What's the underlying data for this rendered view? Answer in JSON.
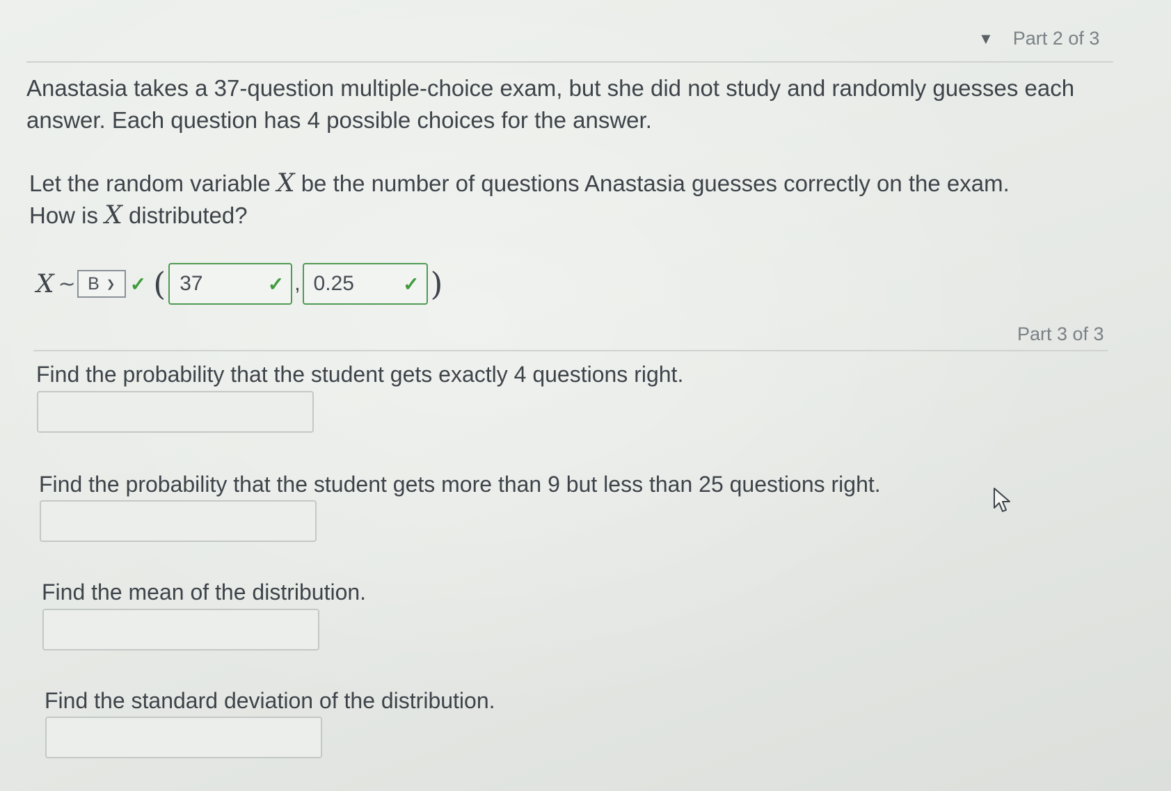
{
  "part2": {
    "toggle_icon": "▼",
    "label": "Part 2 of 3"
  },
  "question": {
    "intro": "Anastasia takes a 37-question multiple-choice exam, but she did not study and randomly guesses each answer. Each question has 4 possible choices for the answer.",
    "let_prefix": "Let the random variable ",
    "var": "X",
    "let_suffix": " be the number of questions Anastasia guesses correctly on the exam.",
    "how_prefix": "How is ",
    "how_suffix": " distributed?"
  },
  "distribution": {
    "variable": "X",
    "tilde": "∼",
    "selected": "B",
    "n_value": "37",
    "p_value": "0.25",
    "check": "✓",
    "open_paren": "(",
    "close_paren": ")",
    "comma": ","
  },
  "part3": {
    "label": "Part 3 of 3",
    "q_exact": "Find the probability that the student gets exactly 4 questions right.",
    "q_range": "Find the probability that the student gets more than 9 but less than 25 questions right.",
    "q_mean": "Find the mean of the distribution.",
    "q_sd": "Find the standard deviation of the distribution."
  },
  "colors": {
    "correct_green": "#3f9a3c",
    "text": "#3d4349"
  },
  "icons": {
    "toggle": "triangle-down-icon",
    "cursor": "mouse-pointer-icon",
    "check": "checkmark-icon",
    "dropdown": "chevron-down-icon"
  }
}
